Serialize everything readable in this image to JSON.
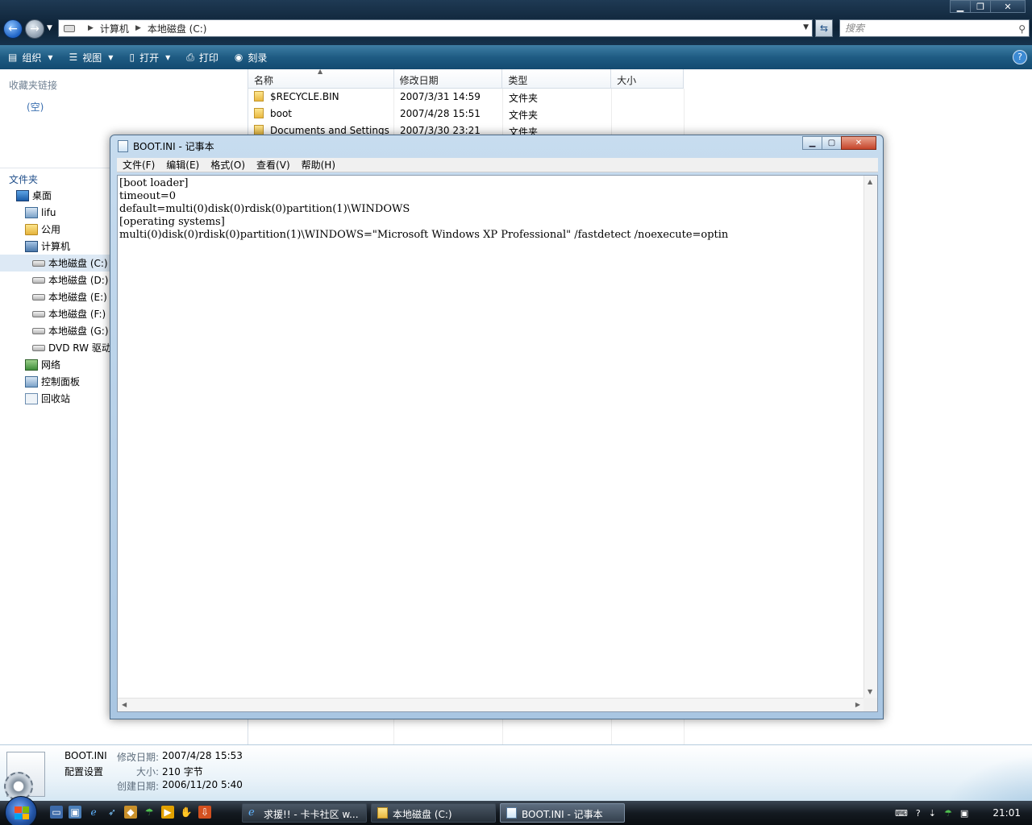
{
  "explorer": {
    "breadcrumb": [
      "计算机",
      "本地磁盘 (C:)"
    ],
    "search_placeholder": "搜索",
    "toolbar": [
      {
        "icon": "organize-icon",
        "label": "组织",
        "dropdown": true
      },
      {
        "icon": "views-icon",
        "label": "视图",
        "dropdown": true
      },
      {
        "icon": "open-icon",
        "label": "打开",
        "dropdown": true
      },
      {
        "icon": "print-icon",
        "label": "打印",
        "dropdown": false
      },
      {
        "icon": "burn-icon",
        "label": "刻录",
        "dropdown": false
      }
    ],
    "nav": {
      "favorites_title": "收藏夹链接",
      "favorites_empty": "(空)",
      "folders_title": "文件夹",
      "tree": [
        {
          "label": "桌面",
          "icon": "desktop-icon",
          "indent": 1
        },
        {
          "label": "lifu",
          "icon": "user-folder-icon",
          "indent": 2
        },
        {
          "label": "公用",
          "icon": "folder-icon",
          "indent": 2
        },
        {
          "label": "计算机",
          "icon": "computer-icon",
          "indent": 2
        },
        {
          "label": "本地磁盘 (C:)",
          "icon": "drive-icon",
          "indent": 3,
          "selected": true
        },
        {
          "label": "本地磁盘 (D:)",
          "icon": "drive-icon",
          "indent": 3
        },
        {
          "label": "本地磁盘 (E:)",
          "icon": "drive-icon",
          "indent": 3
        },
        {
          "label": "本地磁盘 (F:)",
          "icon": "drive-icon",
          "indent": 3
        },
        {
          "label": "本地磁盘 (G:)",
          "icon": "drive-icon",
          "indent": 3
        },
        {
          "label": "DVD RW 驱动",
          "icon": "dvd-drive-icon",
          "indent": 3
        },
        {
          "label": "网络",
          "icon": "network-icon",
          "indent": 2
        },
        {
          "label": "控制面板",
          "icon": "control-panel-icon",
          "indent": 2
        },
        {
          "label": "回收站",
          "icon": "recycle-bin-icon",
          "indent": 2
        }
      ]
    },
    "columns": [
      "名称",
      "修改日期",
      "类型",
      "大小"
    ],
    "files": [
      {
        "name": "$RECYCLE.BIN",
        "date": "2007/3/31 14:59",
        "type": "文件夹",
        "size": ""
      },
      {
        "name": "boot",
        "date": "2007/4/28 15:51",
        "type": "文件夹",
        "size": ""
      },
      {
        "name": "Documents and Settings",
        "date": "2007/3/30 23:21",
        "type": "文件夹",
        "size": ""
      }
    ],
    "details": {
      "name": "BOOT.INI",
      "type": "配置设置",
      "modified_label": "修改日期:",
      "modified": "2007/4/28 15:53",
      "size_label": "大小:",
      "size": "210 字节",
      "created_label": "创建日期:",
      "created": "2006/11/20 5:40"
    }
  },
  "notepad": {
    "title": "BOOT.INI - 记事本",
    "menu": [
      "文件(F)",
      "编辑(E)",
      "格式(O)",
      "查看(V)",
      "帮助(H)"
    ],
    "content": "[boot loader]\ntimeout=0\ndefault=multi(0)disk(0)rdisk(0)partition(1)\\WINDOWS\n[operating systems]\nmulti(0)disk(0)rdisk(0)partition(1)\\WINDOWS=\"Microsoft Windows XP Professional\" /fastdetect /noexecute=optin"
  },
  "taskbar": {
    "tasks": [
      {
        "label": "求援!! - 卡卡社区 w...",
        "icon": "ie-icon",
        "active": false
      },
      {
        "label": "本地磁盘 (C:)",
        "icon": "folder-icon",
        "active": false
      },
      {
        "label": "BOOT.INI - 记事本",
        "icon": "notepad-icon",
        "active": true
      }
    ],
    "clock": "21:01"
  }
}
